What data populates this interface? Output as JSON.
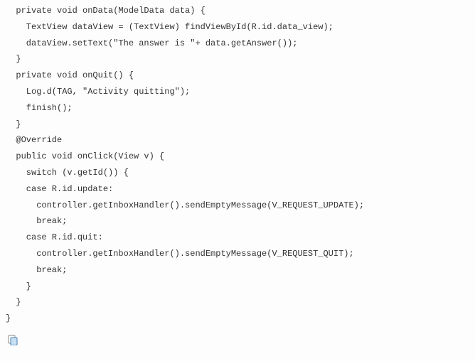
{
  "code": {
    "lines": [
      "  private void onData(ModelData data) {",
      "    TextView dataView = (TextView) findViewById(R.id.data_view);",
      "    dataView.setText(\"The answer is \"+ data.getAnswer());",
      "  }",
      "",
      "  private void onQuit() {",
      "    Log.d(TAG, \"Activity quitting\");",
      "    finish();",
      "  }",
      "",
      "  @Override",
      "  public void onClick(View v) {",
      "    switch (v.getId()) {",
      "    case R.id.update:",
      "      controller.getInboxHandler().sendEmptyMessage(V_REQUEST_UPDATE);",
      "      break;",
      "    case R.id.quit:",
      "      controller.getInboxHandler().sendEmptyMessage(V_REQUEST_QUIT);",
      "      break;",
      "    }",
      "  }",
      "}"
    ]
  },
  "icons": {
    "copy": "copy-icon"
  }
}
